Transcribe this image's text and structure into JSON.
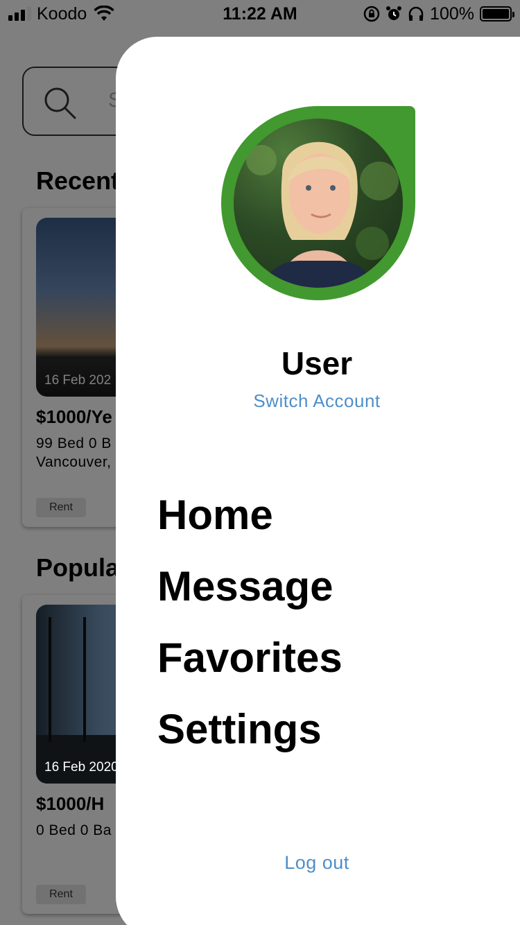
{
  "status_bar": {
    "carrier": "Koodo",
    "time": "11:22 AM",
    "battery_percent": "100%",
    "signal_bars": 4,
    "signal_bars_on": 3,
    "icons": [
      "signal-icon",
      "wifi-icon",
      "orientation-lock-icon",
      "alarm-icon",
      "headphones-icon",
      "battery-icon"
    ]
  },
  "home": {
    "search": {
      "placeholder": "S",
      "icon": "search-icon"
    },
    "sections": [
      {
        "title": "Recent",
        "card": {
          "date": "16 Feb 202",
          "price": "$1000/Ye",
          "desc_line1": "99 Bed 0 B",
          "desc_line2": "Vancouver,",
          "tag": "Rent"
        }
      },
      {
        "title": "Popula",
        "card": {
          "date": "16 Feb 2020",
          "price": "$1000/H",
          "desc_line1": "0 Bed 0 Ba",
          "desc_line2": "",
          "tag": "Rent"
        }
      }
    ]
  },
  "drawer": {
    "accent_color": "#42992f",
    "link_color": "#4f8ec9",
    "user_name": "User",
    "switch_account": "Switch Account",
    "menu": [
      "Home",
      "Message",
      "Favorites",
      "Settings"
    ],
    "logout": "Log out"
  }
}
